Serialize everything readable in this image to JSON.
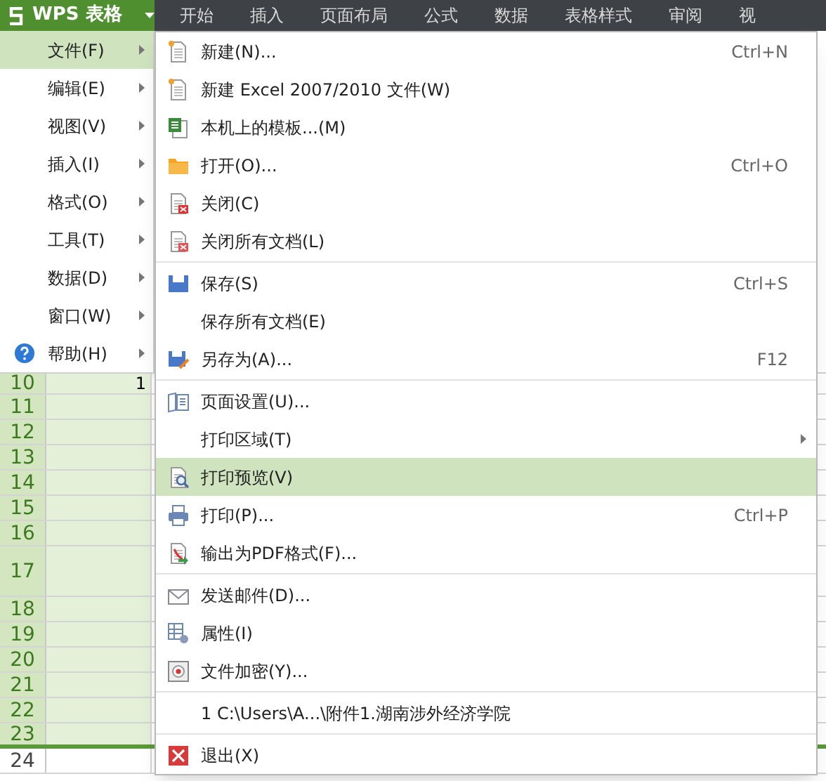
{
  "app_button": {
    "label": "WPS 表格"
  },
  "tabs": [
    {
      "label": "开始",
      "selected": false
    },
    {
      "label": "插入",
      "selected": false
    },
    {
      "label": "页面布局",
      "selected": false
    },
    {
      "label": "公式",
      "selected": false
    },
    {
      "label": "数据",
      "selected": false
    },
    {
      "label": "表格样式",
      "selected": false
    },
    {
      "label": "审阅",
      "selected": false
    },
    {
      "label": "视",
      "selected": false
    }
  ],
  "main_menu": [
    {
      "label": "文件(F)",
      "selected": true,
      "kind": "plain"
    },
    {
      "label": "编辑(E)",
      "selected": false,
      "kind": "plain"
    },
    {
      "label": "视图(V)",
      "selected": false,
      "kind": "plain"
    },
    {
      "label": "插入(I)",
      "selected": false,
      "kind": "plain"
    },
    {
      "label": "格式(O)",
      "selected": false,
      "kind": "plain"
    },
    {
      "label": "工具(T)",
      "selected": false,
      "kind": "plain"
    },
    {
      "label": "数据(D)",
      "selected": false,
      "kind": "plain"
    },
    {
      "label": "窗口(W)",
      "selected": false,
      "kind": "plain"
    },
    {
      "label": "帮助(H)",
      "selected": false,
      "kind": "help"
    }
  ],
  "file_menu": [
    [
      {
        "label": "新建(N)...",
        "shortcut": "Ctrl+N",
        "selected": false
      },
      {
        "label": "新建 Excel 2007/2010 文件(W)",
        "selected": false
      },
      {
        "label": "本机上的模板...(M)",
        "selected": false
      },
      {
        "label": "打开(O)...",
        "shortcut": "Ctrl+O",
        "selected": false
      },
      {
        "label": "关闭(C)",
        "selected": false
      },
      {
        "label": "关闭所有文档(L)",
        "selected": false
      }
    ],
    [
      {
        "label": "保存(S)",
        "shortcut": "Ctrl+S",
        "selected": false
      },
      {
        "label": "保存所有文档(E)",
        "selected": false
      },
      {
        "label": "另存为(A)...",
        "shortcut": "F12",
        "selected": false
      }
    ],
    [
      {
        "label": "页面设置(U)...",
        "selected": false
      },
      {
        "label": "打印区域(T)",
        "selected": false,
        "submenu": true
      },
      {
        "label": "打印预览(V)",
        "selected": true
      },
      {
        "label": "打印(P)...",
        "shortcut": "Ctrl+P",
        "selected": false
      },
      {
        "label": "输出为PDF格式(F)...",
        "selected": false
      }
    ],
    [
      {
        "label": "发送邮件(D)...",
        "selected": false
      },
      {
        "label": "属性(I)",
        "selected": false
      },
      {
        "label": "文件加密(Y)...",
        "selected": false
      }
    ],
    [
      {
        "label": "1 C:\\Users\\A...\\附件1.湖南涉外经济学院",
        "selected": false
      }
    ],
    [
      {
        "label": "退出(X)",
        "selected": false
      }
    ]
  ],
  "rows": [
    {
      "header": "10",
      "selected": true,
      "kind": "normal",
      "cell_a": "1"
    },
    {
      "header": "11",
      "selected": true,
      "kind": "normal"
    },
    {
      "header": "12",
      "selected": true,
      "kind": "normal"
    },
    {
      "header": "13",
      "selected": true,
      "kind": "normal"
    },
    {
      "header": "14",
      "selected": true,
      "kind": "normal"
    },
    {
      "header": "15",
      "selected": true,
      "kind": "normal"
    },
    {
      "header": "16",
      "selected": true,
      "kind": "normal"
    },
    {
      "header": "17",
      "selected": true,
      "kind": "tall"
    },
    {
      "header": "18",
      "selected": true,
      "kind": "normal"
    },
    {
      "header": "19",
      "selected": true,
      "kind": "normal"
    },
    {
      "header": "20",
      "selected": true,
      "kind": "normal"
    },
    {
      "header": "21",
      "selected": true,
      "kind": "normal"
    },
    {
      "header": "22",
      "selected": true,
      "kind": "normal"
    },
    {
      "header": "23",
      "selected": true,
      "kind": "normal"
    },
    {
      "header": "24",
      "selected": false,
      "kind": "normal"
    }
  ]
}
